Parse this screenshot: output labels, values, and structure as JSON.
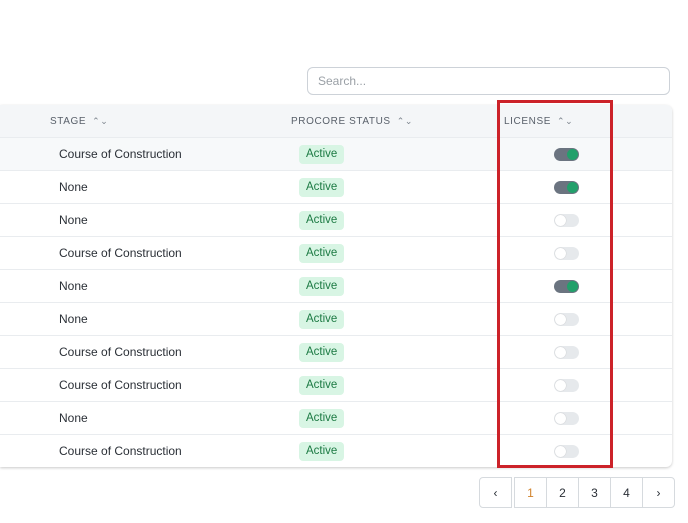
{
  "search": {
    "placeholder": "Search..."
  },
  "table": {
    "columns": {
      "stage": "STAGE",
      "status": "PROCORE STATUS",
      "license": "LICENSE"
    },
    "rows": [
      {
        "stage": "Course of Construction",
        "status": "Active",
        "license_on": true
      },
      {
        "stage": "None",
        "status": "Active",
        "license_on": true
      },
      {
        "stage": "None",
        "status": "Active",
        "license_on": false
      },
      {
        "stage": "Course of Construction",
        "status": "Active",
        "license_on": false
      },
      {
        "stage": "None",
        "status": "Active",
        "license_on": true
      },
      {
        "stage": "None",
        "status": "Active",
        "license_on": false
      },
      {
        "stage": "Course of Construction",
        "status": "Active",
        "license_on": false
      },
      {
        "stage": "Course of Construction",
        "status": "Active",
        "license_on": false
      },
      {
        "stage": "None",
        "status": "Active",
        "license_on": false
      },
      {
        "stage": "Course of Construction",
        "status": "Active",
        "license_on": false
      }
    ]
  },
  "pagination": {
    "prev": "‹",
    "pages": [
      "1",
      "2",
      "3",
      "4"
    ],
    "current": "1",
    "next": "›"
  },
  "icons": {
    "sort": "sort-icon",
    "prev": "chevron-left-icon",
    "next": "chevron-right-icon"
  },
  "colors": {
    "active_badge_bg": "#d8f5e4",
    "active_badge_text": "#1c7a43",
    "toggle_on": "#22a06b",
    "highlight": "#cc2229",
    "current_page": "#d1832c"
  }
}
